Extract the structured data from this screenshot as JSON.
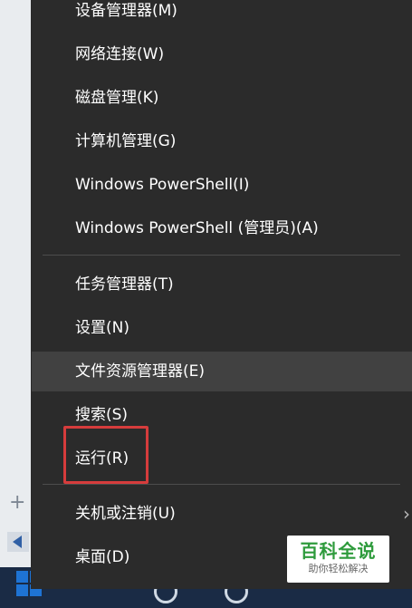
{
  "menu": {
    "items": [
      {
        "label": "设备管理器(M)"
      },
      {
        "label": "网络连接(W)"
      },
      {
        "label": "磁盘管理(K)"
      },
      {
        "label": "计算机管理(G)"
      },
      {
        "label": "Windows PowerShell(I)"
      },
      {
        "label": "Windows PowerShell (管理员)(A)"
      },
      {
        "label": "任务管理器(T)"
      },
      {
        "label": "设置(N)"
      },
      {
        "label": "文件资源管理器(E)"
      },
      {
        "label": "搜索(S)"
      },
      {
        "label": "运行(R)"
      },
      {
        "label": "关机或注销(U)"
      },
      {
        "label": "桌面(D)"
      }
    ],
    "hovered_item": "文件资源管理器(E)",
    "highlighted_item": "运行(R)"
  },
  "watermark": {
    "title": "百科全说",
    "subtitle": "助你轻松解决"
  },
  "colors": {
    "menu_bg": "#2b2b2b",
    "hover_bg": "#414141",
    "highlight": "#d63c3c",
    "watermark_green": "#2e9b3c"
  }
}
